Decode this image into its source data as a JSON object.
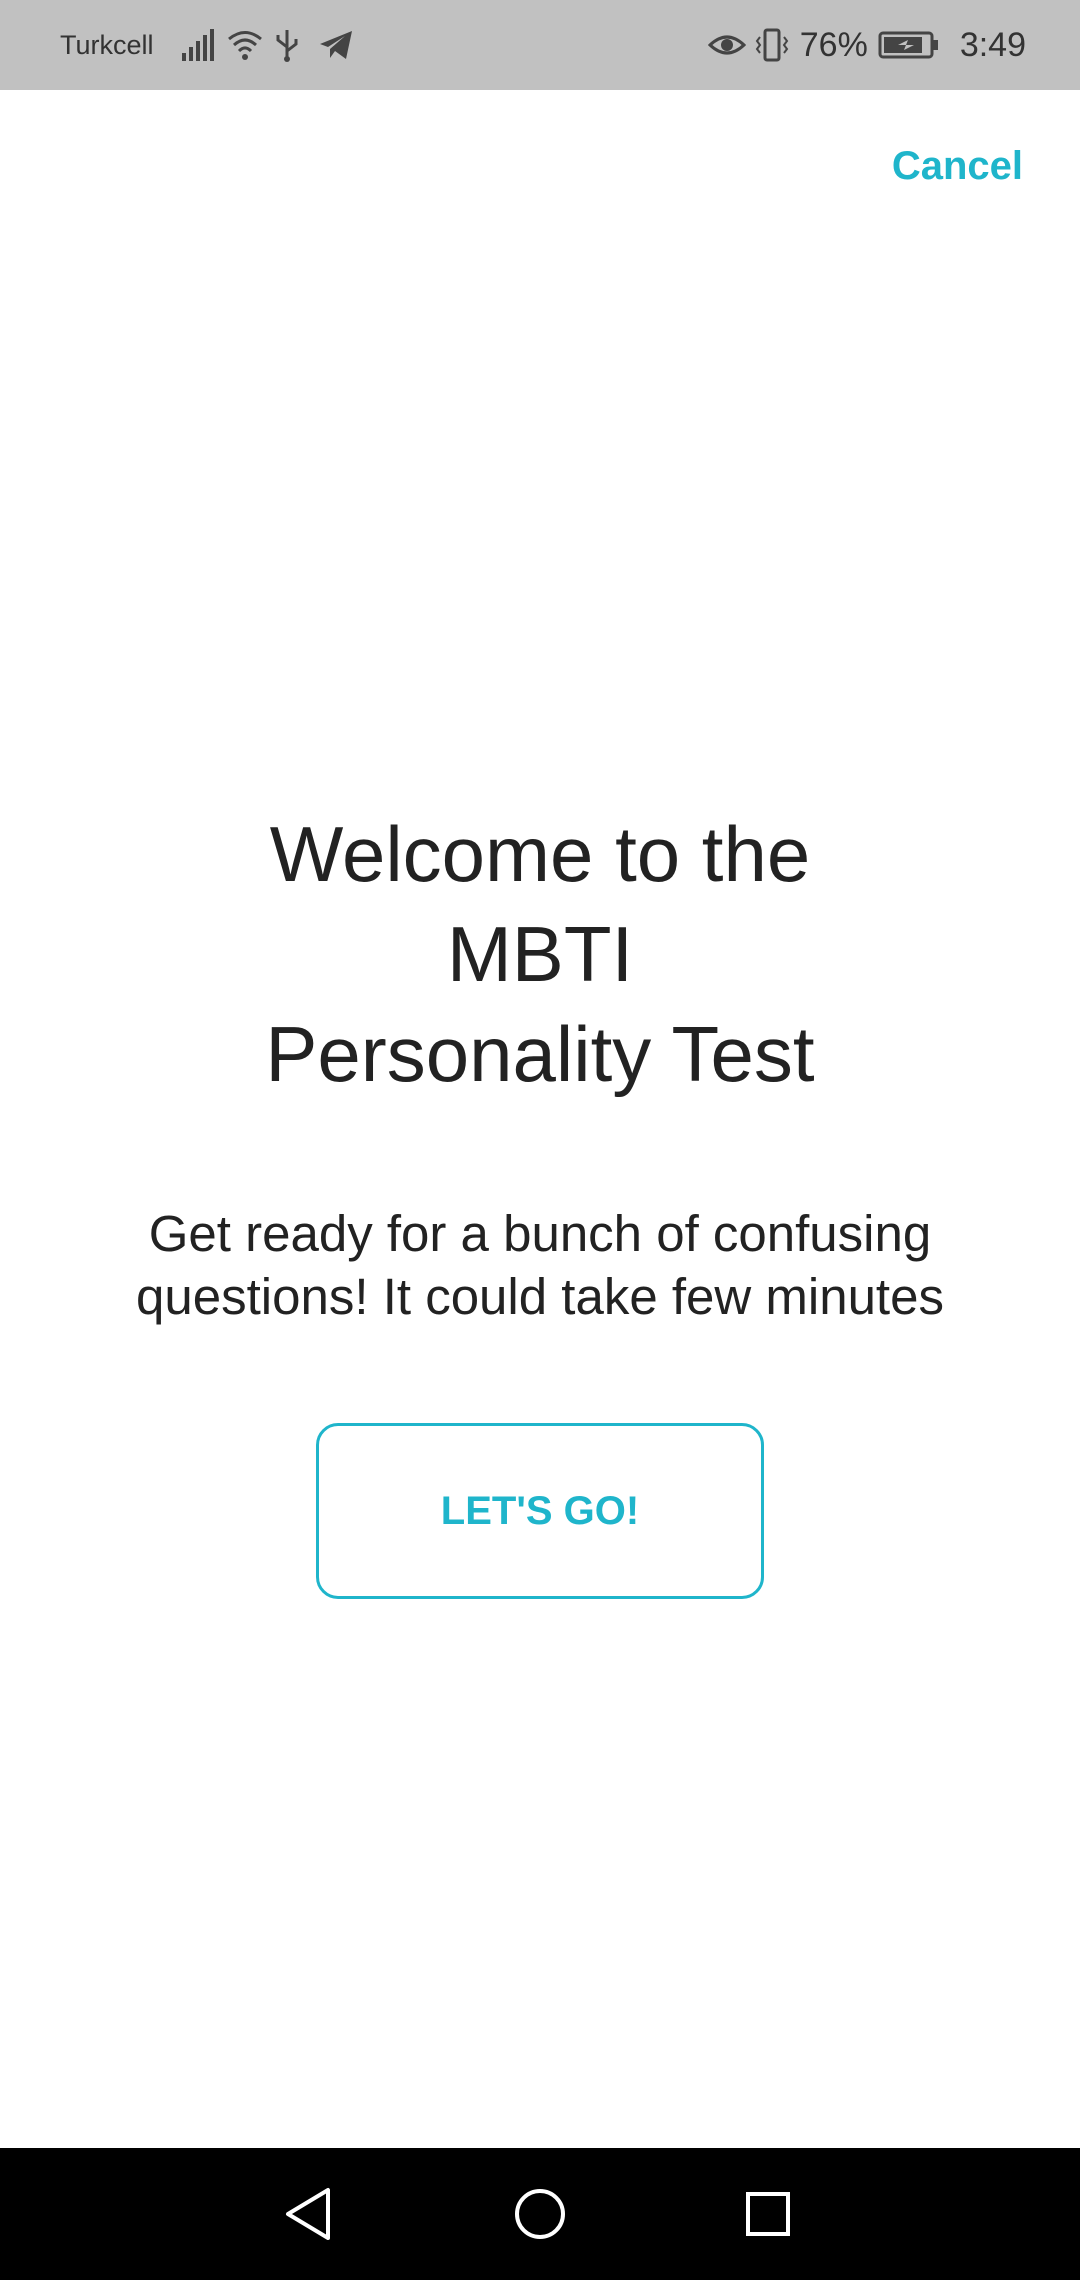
{
  "status_bar": {
    "carrier": "Turkcell",
    "battery_percent": "76%",
    "time": "3:49",
    "icons": [
      "signal-icon",
      "wifi-icon",
      "usb-icon",
      "telegram-icon",
      "eye-icon",
      "vibrate-icon",
      "battery-icon"
    ]
  },
  "header": {
    "cancel_label": "Cancel"
  },
  "main": {
    "title_lines": [
      "Welcome to the",
      "MBTI",
      "Personality Test"
    ],
    "subtitle_lines": [
      "Get ready for a bunch of confusing",
      "questions! It could take few minutes"
    ],
    "button_label": "LET'S GO!"
  },
  "nav_bar": {
    "buttons": [
      "back-icon",
      "home-icon",
      "recents-icon"
    ]
  },
  "colors": {
    "accent": "#1fb5cb",
    "status_bar_bg": "#c1c1c1",
    "text": "#222222",
    "nav_bar_bg": "#000000"
  }
}
